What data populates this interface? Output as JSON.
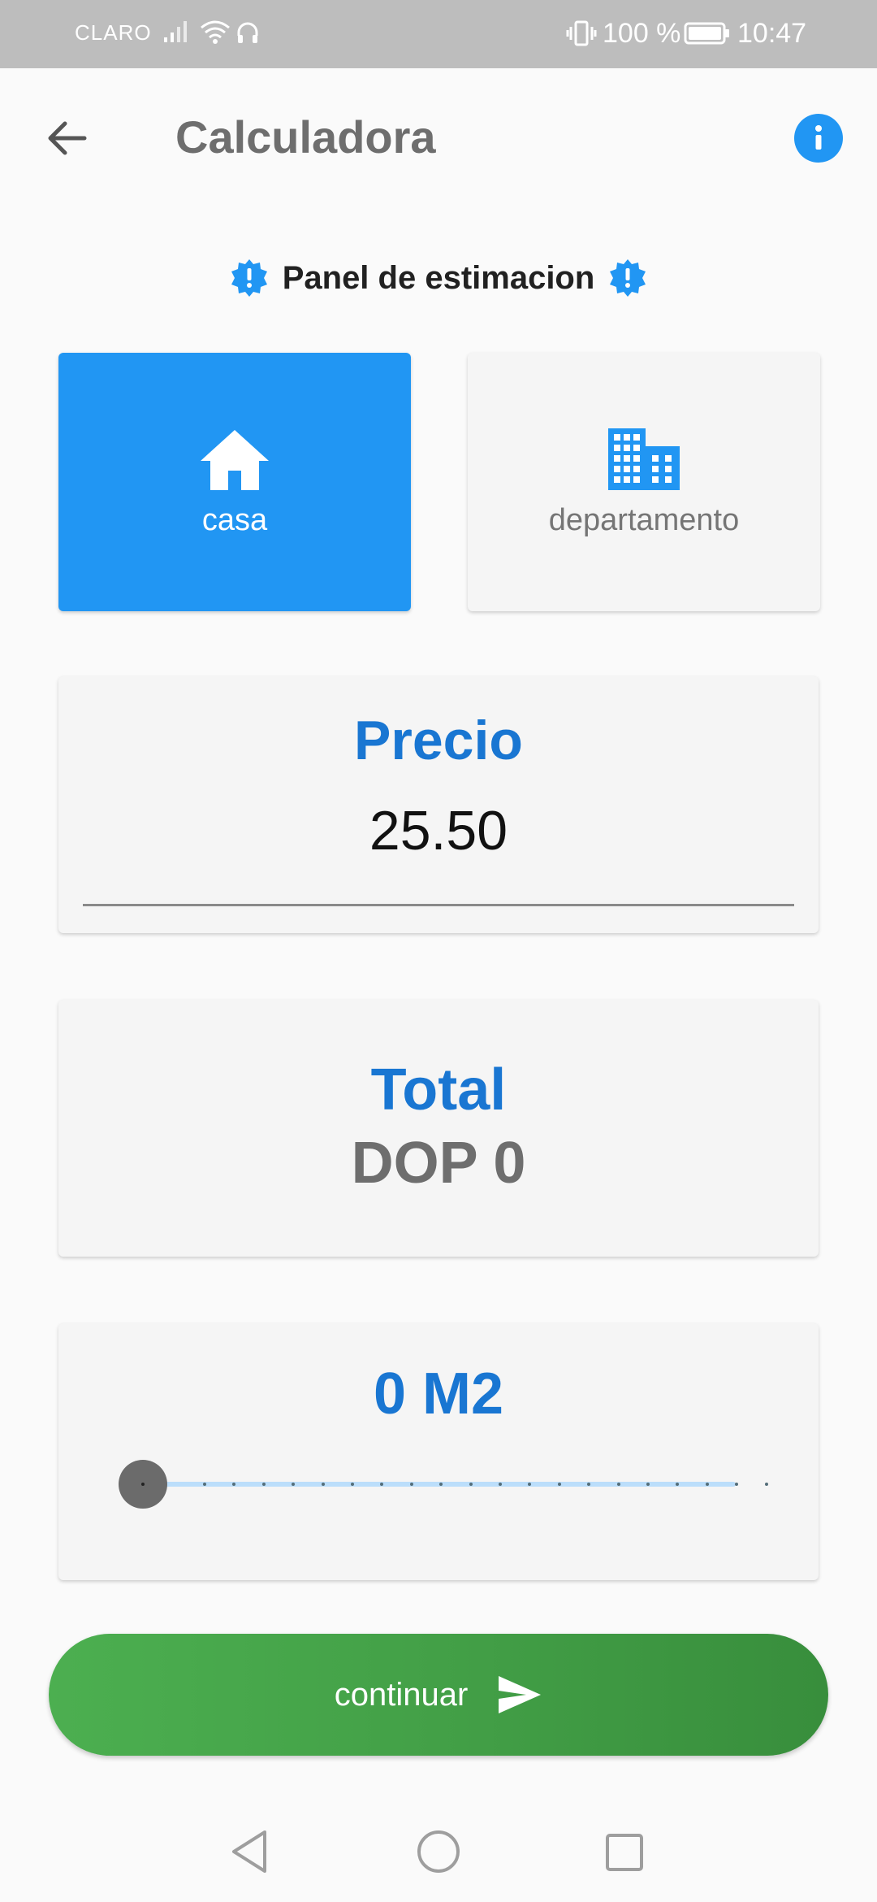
{
  "status_bar": {
    "carrier": "CLARO",
    "battery_percent": "100 %",
    "time": "10:47",
    "icons": [
      "signal-icon",
      "wifi-icon",
      "headset-icon",
      "vibrate-icon",
      "battery-icon"
    ]
  },
  "app_bar": {
    "title": "Calculadora",
    "back_icon": "arrow-left-icon",
    "info_icon": "info-icon"
  },
  "panel": {
    "heading": "Panel de estimacion",
    "badge_icon": "alert-badge-icon"
  },
  "property_types": [
    {
      "label": "casa",
      "icon": "house-icon",
      "selected": true
    },
    {
      "label": "departamento",
      "icon": "building-icon",
      "selected": false
    }
  ],
  "precio": {
    "label": "Precio",
    "value": "25.50"
  },
  "total": {
    "label": "Total",
    "value": "DOP 0"
  },
  "area": {
    "label": "0 M2",
    "slider_value": 0
  },
  "continue_button": {
    "label": "continuar",
    "icon": "send-icon"
  },
  "nav_bar": {
    "icons": [
      "nav-back-icon",
      "nav-home-icon",
      "nav-recents-icon"
    ]
  },
  "colors": {
    "primary_blue": "#2196f3",
    "heading_blue": "#1976d2",
    "button_green": "#4caf50",
    "status_bar": "#bdbdbd"
  }
}
